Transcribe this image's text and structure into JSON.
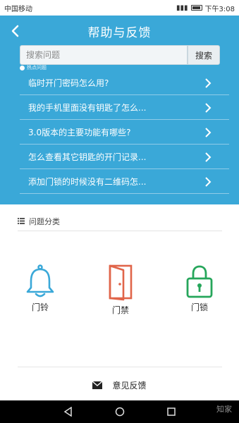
{
  "status_bar": {
    "carrier": "中国移动",
    "time": "下午3:08"
  },
  "header": {
    "title": "帮助与反馈",
    "bg_color": "#3aa8d8"
  },
  "search": {
    "placeholder": "搜索问题",
    "button_label": "搜索"
  },
  "hot": {
    "label": "热点问题"
  },
  "faq": {
    "items": [
      {
        "label": "临时开门密码怎么用?"
      },
      {
        "label": "我的手机里面没有钥匙了怎么..."
      },
      {
        "label": "3.0版本的主要功能有哪些?"
      },
      {
        "label": "怎么查看其它钥匙的开门记录..."
      },
      {
        "label": "添加门锁的时候没有二维码怎..."
      }
    ]
  },
  "categories": {
    "header_label": "问题分类",
    "items": [
      {
        "label": "门铃",
        "icon": "bell-icon",
        "color": "#3aa8d8"
      },
      {
        "label": "门禁",
        "icon": "door-icon",
        "color": "#e0654a"
      },
      {
        "label": "门锁",
        "icon": "lock-icon",
        "color": "#26a65b"
      }
    ]
  },
  "feedback": {
    "label": "意见反馈",
    "icon": "envelope-icon"
  },
  "watermark": "知家"
}
